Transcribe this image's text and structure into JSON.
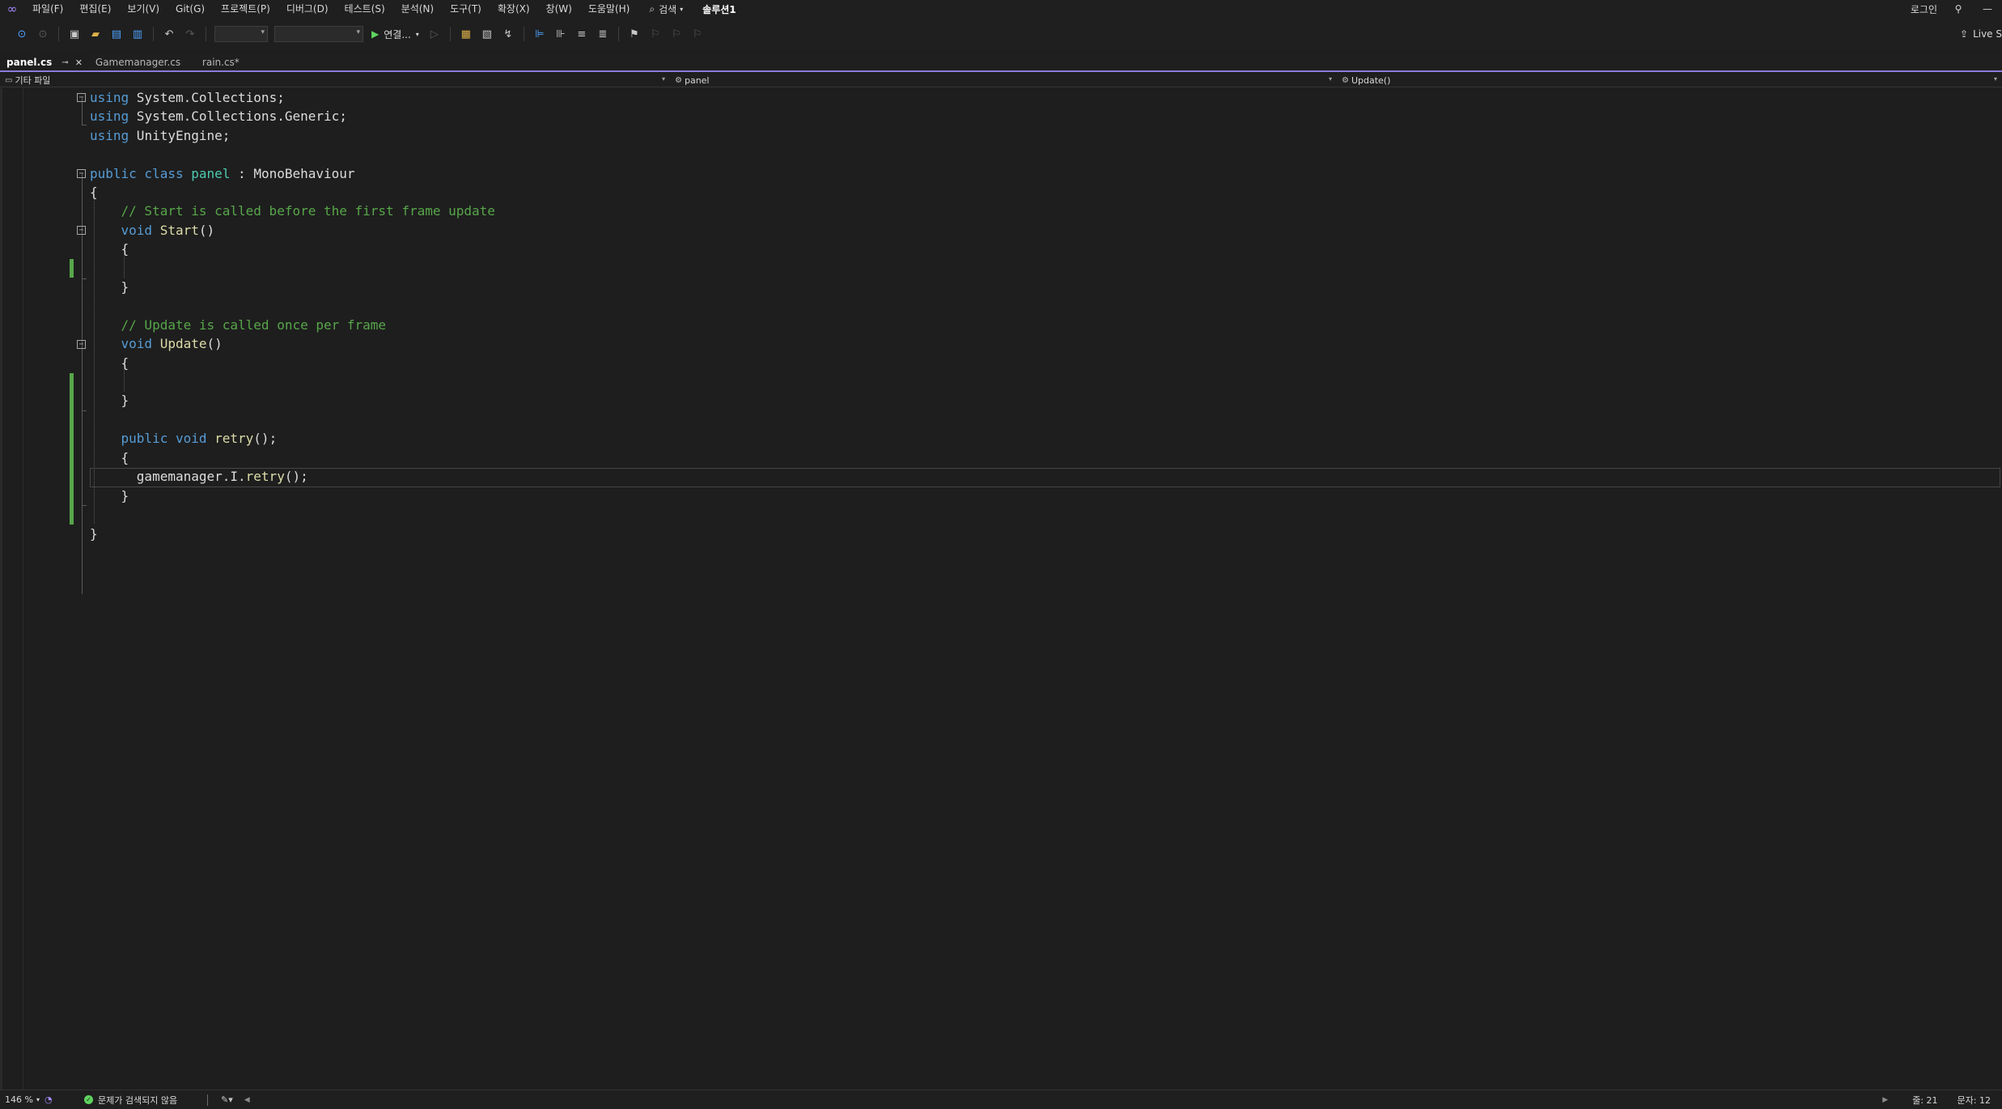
{
  "menubar": {
    "items": [
      "파일(F)",
      "편집(E)",
      "보기(V)",
      "Git(G)",
      "프로젝트(P)",
      "디버그(D)",
      "테스트(S)",
      "분석(N)",
      "도구(T)",
      "확장(X)",
      "창(W)",
      "도움말(H)"
    ],
    "search_label": "검색",
    "solution_name": "솔루션1",
    "login_label": "로그인",
    "minimize_label": "—"
  },
  "toolbar": {
    "run_label": "연결...",
    "live_share_label": "Live S"
  },
  "tabs": [
    {
      "label": "panel.cs",
      "active": true,
      "pin": "⊸",
      "close": "✕"
    },
    {
      "label": "Gamemanager.cs",
      "active": false
    },
    {
      "label": "rain.cs*",
      "active": false
    }
  ],
  "navbar": {
    "project_label": "기타 파일",
    "class_label": "panel",
    "member_label": "Update()"
  },
  "editor": {
    "lines": [
      [
        [
          "kw",
          "using"
        ],
        [
          "tx",
          " System.Collections;"
        ]
      ],
      [
        [
          "kw",
          "using"
        ],
        [
          "tx",
          " System.Collections.Generic;"
        ]
      ],
      [
        [
          "kw",
          "using"
        ],
        [
          "tx",
          " UnityEngine;"
        ]
      ],
      [],
      [
        [
          "kw",
          "public class "
        ],
        [
          "tp",
          "panel"
        ],
        [
          "tx",
          " : "
        ],
        [
          "tx",
          "MonoBehaviour"
        ]
      ],
      [
        [
          "tx",
          "{"
        ]
      ],
      [
        [
          "cm",
          "    // Start is called before the first frame update"
        ]
      ],
      [
        [
          "kw",
          "    void "
        ],
        [
          "fn",
          "Start"
        ],
        [
          "tx",
          "()"
        ]
      ],
      [
        [
          "tx",
          "    {"
        ]
      ],
      [],
      [
        [
          "tx",
          "    }"
        ]
      ],
      [],
      [
        [
          "cm",
          "    // Update is called once per frame"
        ]
      ],
      [
        [
          "kw",
          "    void "
        ],
        [
          "fn",
          "Update"
        ],
        [
          "tx",
          "()"
        ]
      ],
      [
        [
          "tx",
          "    {"
        ]
      ],
      [],
      [
        [
          "tx",
          "    }"
        ]
      ],
      [],
      [
        [
          "kw",
          "    public void "
        ],
        [
          "fn",
          "retry"
        ],
        [
          "tx",
          "();"
        ]
      ],
      [
        [
          "tx",
          "    {"
        ]
      ],
      [
        [
          "tx",
          "      gamemanager.I."
        ],
        [
          "fn",
          "retry"
        ],
        [
          "tx",
          "();"
        ]
      ],
      [
        [
          "tx",
          "    }"
        ]
      ],
      [],
      [
        [
          "tx",
          "}"
        ]
      ]
    ]
  },
  "statusbar": {
    "zoom": "146 %",
    "issues": "문제가 검색되지 않음",
    "line": "줄: 21",
    "col": "문자: 12"
  }
}
